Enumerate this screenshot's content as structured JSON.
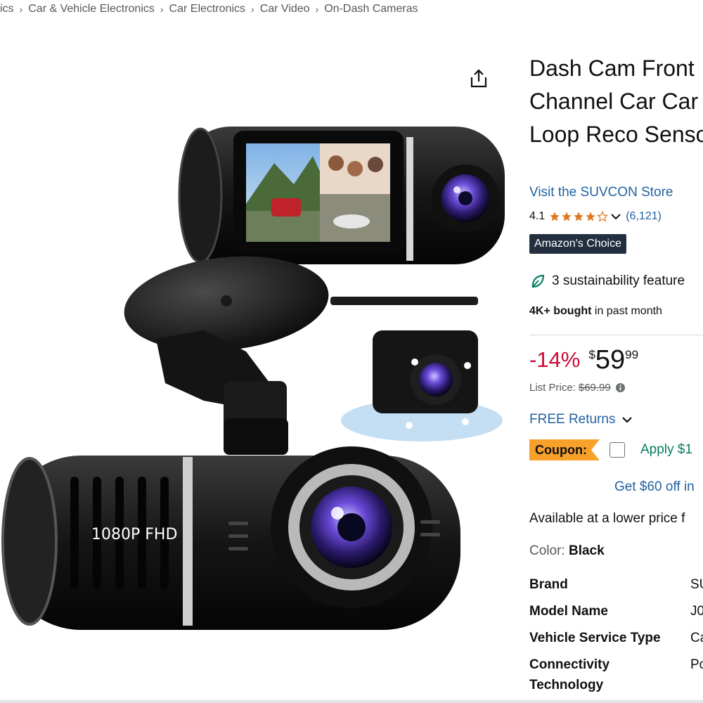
{
  "breadcrumb": [
    "ics",
    "Car & Vehicle Electronics",
    "Car Electronics",
    "Car Video",
    "On-Dash Cameras"
  ],
  "image": {
    "cam_label": "1080P FHD"
  },
  "product": {
    "title": "Dash Cam Front Channel Car Car Card, Loop Reco Sensor",
    "store_link": "Visit the SUVCON Store",
    "rating": "4.1",
    "stars_filled": 4.1,
    "rating_count": "(6,121)",
    "badge": "Amazon's Choice",
    "sustainability": "3 sustainability feature",
    "bought_bold": "4K+ bought",
    "bought_rest": " in past month",
    "discount": "-14%",
    "price_symbol": "$",
    "price_whole": "59",
    "price_fraction": "99",
    "list_price_label": "List Price:",
    "list_price": "$69.99",
    "returns": "FREE Returns",
    "coupon_label": "Coupon:",
    "coupon_apply": "Apply $1",
    "get_off": "Get $60 off in",
    "lower_price": "Available at a lower price f",
    "color_label": "Color: ",
    "color_value": "Black"
  },
  "specs": [
    {
      "label": "Brand",
      "value": "SU"
    },
    {
      "label": "Model Name",
      "value": "J0"
    },
    {
      "label": "Vehicle Service Type",
      "value": "Ca"
    },
    {
      "label": "Connectivity Technology",
      "label_line1": "Connectivity",
      "label_line2": "Technology",
      "value": "Po"
    }
  ],
  "colors": {
    "link": "#2162a1",
    "discount": "#cc0c39",
    "badge_bg": "#232f3e",
    "coupon_bg": "#f7a12b",
    "coupon_apply": "#067d62",
    "star": "#de7921"
  }
}
